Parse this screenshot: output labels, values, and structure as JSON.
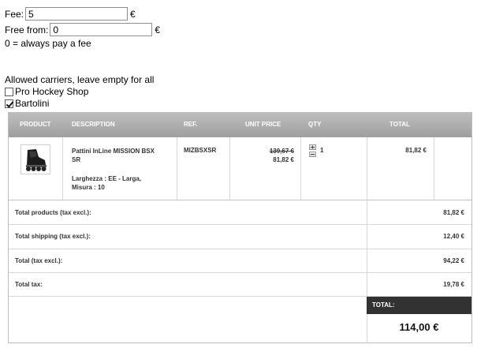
{
  "fee": {
    "label": "Fee:",
    "value": "5",
    "currency": "€"
  },
  "free_from": {
    "label": "Free from:",
    "value": "0",
    "currency": "€"
  },
  "hint": "0 = always pay a fee",
  "carriers": {
    "title": "Allowed carriers, leave empty for all",
    "items": [
      {
        "label": "Pro Hockey Shop",
        "checked": false
      },
      {
        "label": "Bartolini",
        "checked": true
      }
    ]
  },
  "cart": {
    "headers": {
      "product": "PRODUCT",
      "description": "DESCRIPTION",
      "ref": "REF.",
      "unit_price": "UNIT PRICE",
      "qty": "QTY",
      "total": "TOTAL"
    },
    "item": {
      "name_line1": "Pattini InLine MISSION BSX",
      "name_line2": "SR",
      "attributes_line1": "Larghezza : EE - Larga,",
      "attributes_line2": "Misura : 10",
      "ref": "MIZBSXSR",
      "old_price": "139,67 €",
      "price": "81,82 €",
      "qty": "1",
      "total": "81,82 €"
    },
    "summary": {
      "products_label": "Total products (tax excl.):",
      "products_value": "81,82 €",
      "shipping_label": "Total shipping (tax excl.):",
      "shipping_value": "12,40 €",
      "total_excl_label": "Total (tax excl.):",
      "total_excl_value": "94,22 €",
      "tax_label": "Total tax:",
      "tax_value": "19,78 €",
      "grand_label": "TOTAL:",
      "grand_value": "114,00 €"
    }
  }
}
